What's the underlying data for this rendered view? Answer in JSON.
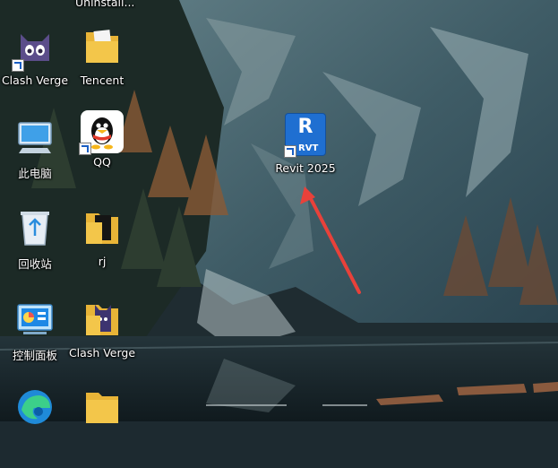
{
  "desktop": {
    "icons": {
      "top_partial": {
        "label": "Uninstall..."
      },
      "clash_verge_1": {
        "label": "Clash Verge",
        "icon": "cat-icon"
      },
      "tencent": {
        "label": "Tencent",
        "icon": "folder-icon"
      },
      "this_pc": {
        "label": "此电脑",
        "icon": "computer-icon"
      },
      "qq": {
        "label": "QQ",
        "icon": "penguin-icon"
      },
      "revit": {
        "label": "Revit 2025",
        "icon": "revit-icon",
        "badge": "RVT",
        "letter": "R"
      },
      "recycle_bin": {
        "label": "回收站",
        "icon": "recycle-bin-icon"
      },
      "rj": {
        "label": "rj",
        "icon": "folder-icon"
      },
      "control_panel": {
        "label": "控制面板",
        "icon": "control-panel-icon"
      },
      "clash_verge_2": {
        "label": "Clash Verge",
        "icon": "folder-icon"
      }
    }
  },
  "colors": {
    "revit_blue": "#1f6fd1",
    "folder_yellow": "#f3c64a",
    "arrow_red": "#e8413a"
  }
}
